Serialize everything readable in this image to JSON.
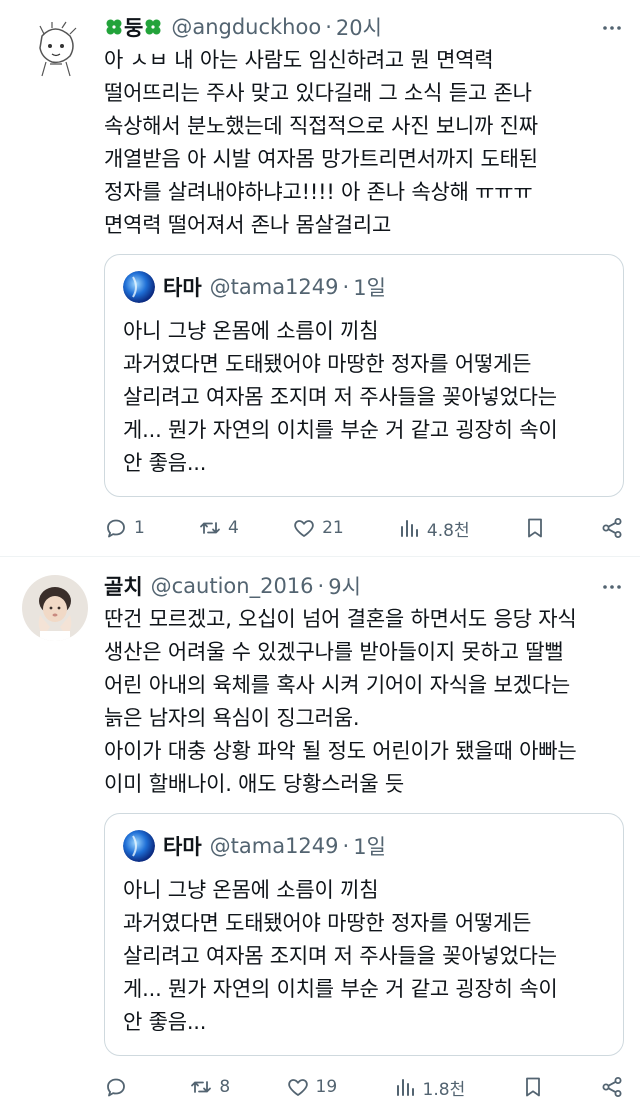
{
  "tweets": [
    {
      "name": "둥",
      "handle": "@angduckhoo",
      "dot": "·",
      "time": "20시",
      "text": "아 ㅅㅂ 내 아는 사람도 임신하려고 뭔 면역력\n떨어뜨리는 주사 맞고 있다길래 그 소식 듣고 존나\n속상해서 분노했는데 직접적으로 사진 보니까 진짜\n개열받음 아 시발 여자몸 망가트리면서까지 도태된\n정자를 살려내야하냐고!!!! 아 존나 속상해 ㅠㅠㅠ\n면역력 떨어져서 존나 몸살걸리고",
      "quote": {
        "name": "타마",
        "handle": "@tama1249",
        "dot": "·",
        "time": "1일",
        "text": "아니 그냥 온몸에 소름이 끼침\n과거였다면 도태됐어야 마땅한 정자를 어떻게든\n살리려고 여자몸 조지며 저 주사들을 꽂아넣었다는\n게... 뭔가 자연의 이치를 부순 거 같고 굉장히 속이\n안 좋음..."
      },
      "stats": {
        "replies": "1",
        "retweets": "4",
        "likes": "21",
        "views": "4.8천"
      }
    },
    {
      "name": "골치",
      "handle": "@caution_2016",
      "dot": "·",
      "time": "9시",
      "text": "딴건 모르겠고, 오십이 넘어 결혼을 하면서도 응당 자식\n생산은 어려울 수 있겠구나를 받아들이지 못하고 딸뻘\n어린 아내의 육체를 혹사 시켜 기어이 자식을 보겠다는\n늙은 남자의 욕심이 징그러움.\n아이가 대충 상황 파악 될 정도 어린이가 됐을때 아빠는\n이미 할배나이. 애도 당황스러울 듯",
      "quote": {
        "name": "타마",
        "handle": "@tama1249",
        "dot": "·",
        "time": "1일",
        "text": "아니 그냥 온몸에 소름이 끼침\n과거였다면 도태됐어야 마땅한 정자를 어떻게든\n살리려고 여자몸 조지며 저 주사들을 꽂아넣었다는\n게... 뭔가 자연의 이치를 부순 거 같고 굉장히 속이\n안 좋음..."
      },
      "stats": {
        "replies": "",
        "retweets": "8",
        "likes": "19",
        "views": "1.8천"
      }
    }
  ],
  "colors": {
    "text": "#0f1419",
    "secondary": "#536471",
    "border": "#cfd9de",
    "clover": "#22a33a"
  },
  "icons": [
    "clover-icon",
    "more-icon",
    "reply-icon",
    "retweet-icon",
    "like-icon",
    "views-icon",
    "bookmark-icon",
    "share-icon"
  ]
}
